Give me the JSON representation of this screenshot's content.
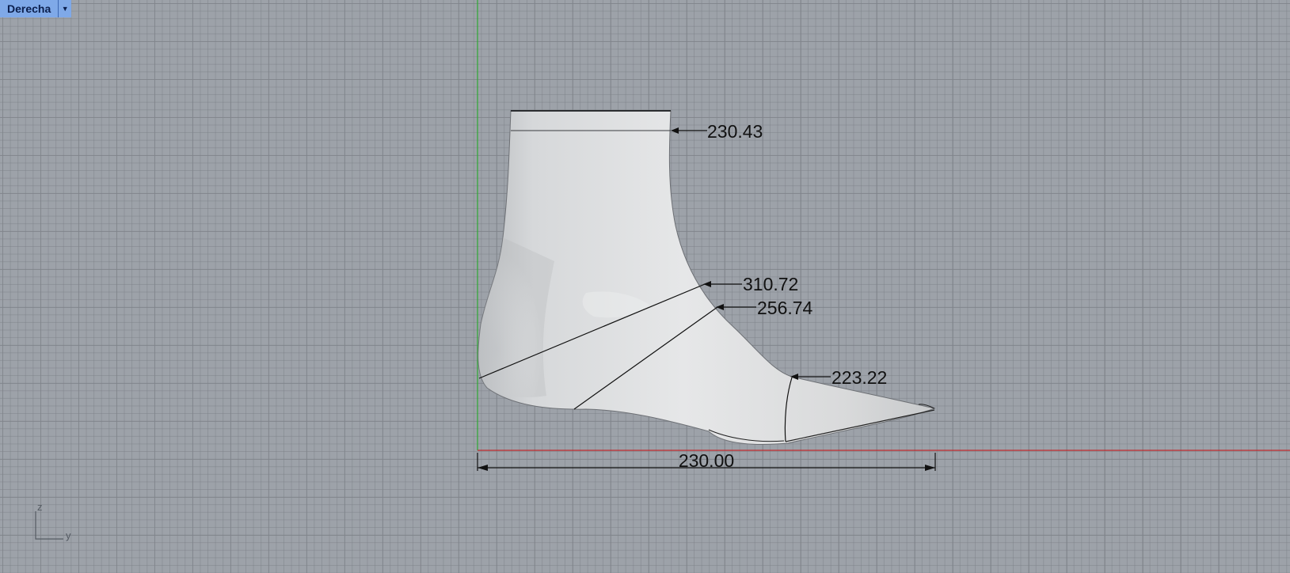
{
  "viewport": {
    "name": "Derecha"
  },
  "dimensions": {
    "top_girth": "230.43",
    "instep_girth": "310.72",
    "waist_girth": "256.74",
    "ball_girth": "223.22",
    "length": "230.00"
  },
  "axes": {
    "vertical": "z",
    "horizontal": "y"
  },
  "colors": {
    "x_axis": "#c0282d",
    "y_axis": "#2ea832",
    "tab": "#7fa9e8"
  }
}
